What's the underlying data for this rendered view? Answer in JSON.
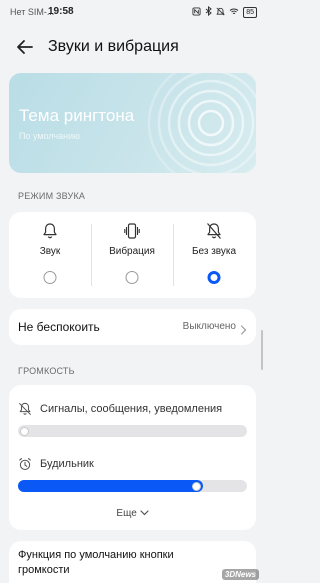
{
  "status_bar": {
    "carrier": "Нет SIM-...",
    "time": "19:58",
    "battery": "85"
  },
  "header": {
    "title": "Звуки и вибрация"
  },
  "ringtone": {
    "title": "Тема рингтона",
    "subtitle": "По умолчанию"
  },
  "sound_mode": {
    "section_label": "РЕЖИМ ЗВУКА",
    "options": [
      {
        "label": "Звук",
        "icon": "bell-icon",
        "selected": false
      },
      {
        "label": "Вибрация",
        "icon": "vibrate-icon",
        "selected": false
      },
      {
        "label": "Без звука",
        "icon": "bell-off-icon",
        "selected": true
      }
    ]
  },
  "do_not_disturb": {
    "label": "Не беспокоить",
    "value": "Выключено"
  },
  "volume": {
    "section_label": "ГРОМКОСТЬ",
    "rows": [
      {
        "label": "Сигналы, сообщения, уведомления",
        "icon": "bell-off-icon",
        "level": 0.0
      },
      {
        "label": "Будильник",
        "icon": "alarm-clock-icon",
        "level": 0.78
      }
    ],
    "more_label": "Еще"
  },
  "volume_buttons": {
    "label": "Функция по умолчанию кнопки громкости"
  },
  "watermark": "3DNews",
  "colors": {
    "accent": "#0a59f7",
    "background": "#f1f3f5",
    "card": "#ffffff"
  }
}
